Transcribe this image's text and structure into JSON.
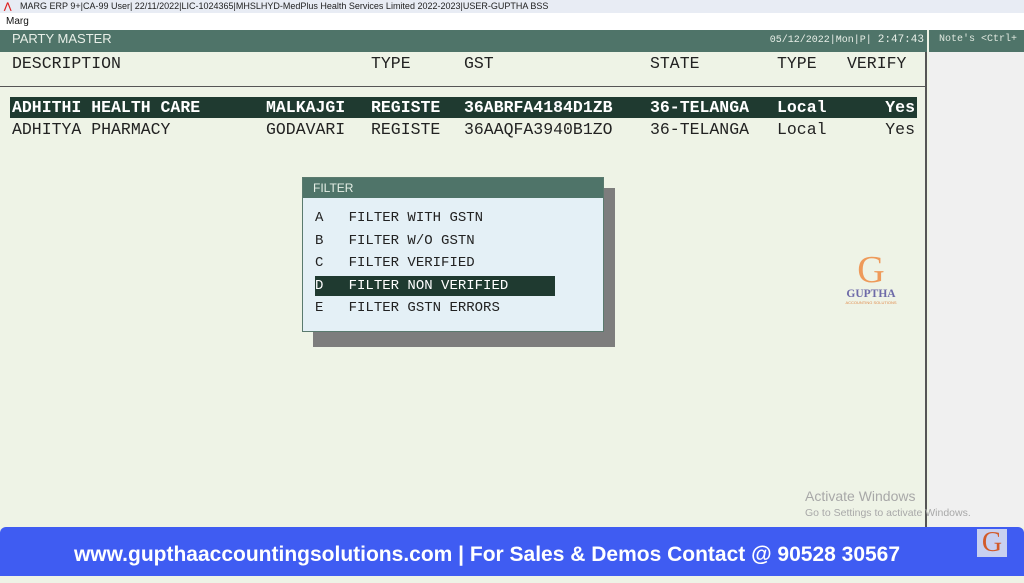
{
  "window": {
    "title": "MARG ERP 9+|CA-99 User| 22/11/2022|LIC-1024365|MHSLHYD-MedPlus Health Services Limited 2022-2023|USER-GUPTHA BSS",
    "menu": "Marg"
  },
  "header": {
    "title": "PARTY MASTER",
    "date": "05/12/2022|Mon|P|",
    "time": "2:47:43"
  },
  "side": {
    "title": "Note's <Ctrl+"
  },
  "columns": [
    "DESCRIPTION",
    "TYPE",
    "GST",
    "STATE",
    "TYPE",
    "VERIFY"
  ],
  "rows": [
    {
      "description": "ADHITHI HEALTH CARE",
      "area": "MALKAJGI",
      "type": "REGISTE",
      "gst": "36ABRFA4184D1ZB",
      "state": "36-TELANGA",
      "ptype": "Local",
      "verify": "Yes",
      "selected": true
    },
    {
      "description": "ADHITYA PHARMACY",
      "area": "GODAVARI",
      "type": "REGISTE",
      "gst": "36AAQFA3940B1ZO",
      "state": "36-TELANGA",
      "ptype": "Local",
      "verify": "Yes",
      "selected": false
    }
  ],
  "filter": {
    "title": "FILTER",
    "options": [
      {
        "key": "A",
        "label": "FILTER WITH GSTN"
      },
      {
        "key": "B",
        "label": "FILTER W/O GSTN"
      },
      {
        "key": "C",
        "label": "FILTER VERIFIED"
      },
      {
        "key": "D",
        "label": "FILTER NON VERIFIED",
        "selected": true
      },
      {
        "key": "E",
        "label": "FILTER GSTN ERRORS"
      }
    ]
  },
  "watermark": {
    "brand": "GUPTHA",
    "tagline": "ACCOUNTING SOLUTIONS"
  },
  "os": {
    "activate": "Activate Windows",
    "activate_sub": "Go to Settings to activate Windows."
  },
  "banner": {
    "text": "www.gupthaaccountingsolutions.com | For Sales & Demos Contact @ 90528 30567"
  },
  "colors": {
    "header": "#4f7469",
    "selection": "#1f3a30",
    "background": "#eef3e6",
    "banner": "#3f5cf2"
  }
}
